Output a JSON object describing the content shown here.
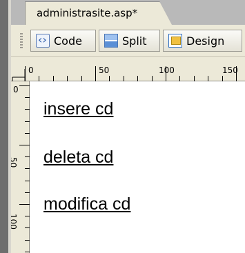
{
  "tab": {
    "title": "administrasite.asp*"
  },
  "toolbar": {
    "code_label": "Code",
    "split_label": "Split",
    "design_label": "Design"
  },
  "ruler": {
    "horizontal_labels": [
      "0",
      "50",
      "100",
      "150"
    ],
    "vertical_labels": [
      "0",
      "50",
      "100"
    ]
  },
  "page": {
    "links": [
      "insere cd",
      "deleta cd",
      "modifica cd"
    ]
  },
  "icons": {
    "code": "code-view-icon",
    "split": "split-view-icon",
    "design": "design-view-icon"
  }
}
